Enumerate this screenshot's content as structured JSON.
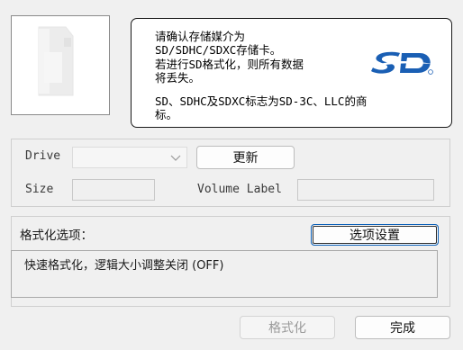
{
  "notice": {
    "line1": "请确认存储媒介为",
    "line2": "SD/SDHC/SDXC存储卡。",
    "line3": "若进行SD格式化，则所有数据",
    "line4": "将丢失。",
    "trademark_line1": "SD、SDHC及SDXC标志为SD-3C、LLC的商",
    "trademark_line2": "标。"
  },
  "drive": {
    "drive_label": "Drive",
    "selected_drive": "",
    "refresh_button": "更新",
    "size_label": "Size",
    "size_value": "",
    "volume_label_label": "Volume Label",
    "volume_label_value": ""
  },
  "format_options": {
    "title": "格式化选项：",
    "settings_button": "选项设置",
    "current_settings": "快速格式化，逻辑大小调整关闭 (OFF)"
  },
  "footer": {
    "format_button": "格式化",
    "done_button": "完成"
  },
  "colors": {
    "window_background": "#f0f0f0",
    "sd_logo_blue": "#1a5fb4",
    "focus_border": "#0a5fb8"
  },
  "icons": {
    "sd_card": "sd-card-icon",
    "sd_logo": "sd-logo-icon",
    "dropdown": "chevron-down-icon"
  }
}
